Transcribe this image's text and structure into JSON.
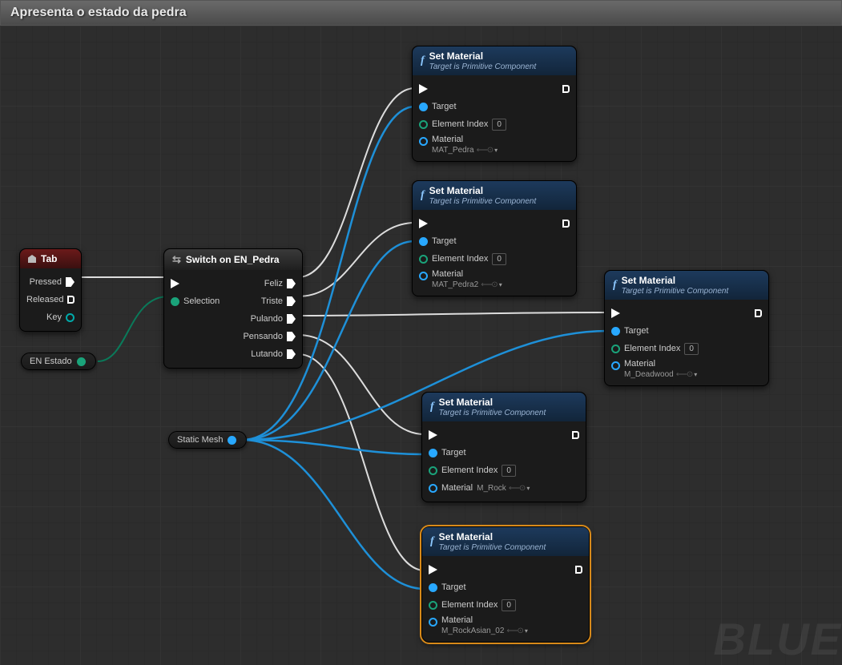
{
  "title": "Apresenta o estado da pedra",
  "watermark": "BLUE",
  "tab_node": {
    "title": "Tab",
    "pressed": "Pressed",
    "released": "Released",
    "key": "Key"
  },
  "switch_node": {
    "title": "Switch on EN_Pedra",
    "selection": "Selection",
    "outs": [
      "Feliz",
      "Triste",
      "Pulando",
      "Pensando",
      "Lutando"
    ]
  },
  "var_estado": "EN Estado",
  "var_mesh": "Static Mesh",
  "setmat": {
    "title": "Set Material",
    "subtitle": "Target is Primitive Component",
    "target": "Target",
    "element": "Element Index",
    "idx": "0",
    "material": "Material"
  },
  "mats": {
    "m1": "MAT_Pedra",
    "m2": "MAT_Pedra2",
    "m3": "M_Deadwood",
    "m4": "M_Rock",
    "m5": "M_RockAsian_02"
  }
}
